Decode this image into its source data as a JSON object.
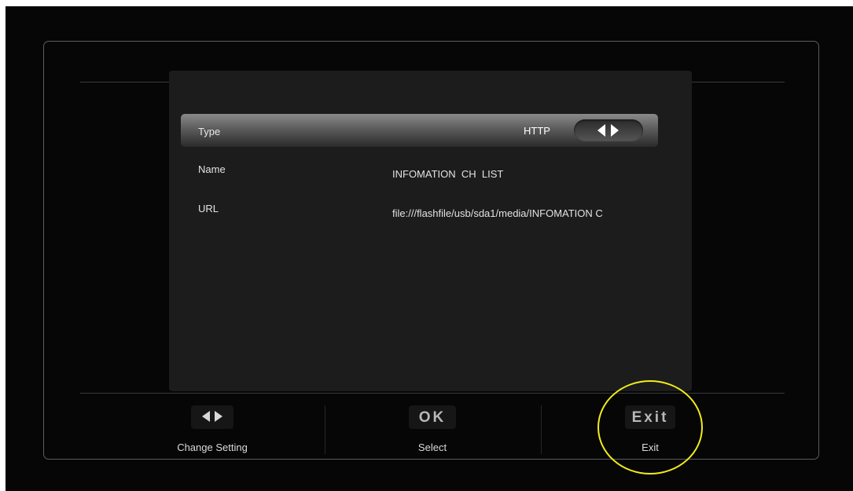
{
  "settings": {
    "rows": [
      {
        "label": "Type",
        "value": "HTTP"
      },
      {
        "label": "Name",
        "value": "INFOMATION  CH  LIST"
      },
      {
        "label": "URL",
        "value": "file:///flashfile/usb/sda1/media/INFOMATION C"
      }
    ],
    "selected_index": 0
  },
  "legend": {
    "change": {
      "key_icon": "left-right-arrows-icon",
      "caption": "Change Setting"
    },
    "select": {
      "key": "OK",
      "caption": "Select"
    },
    "exit": {
      "key": "Exit",
      "caption": "Exit"
    }
  },
  "annotation": {
    "color": "#f2ec1a",
    "target": "exit"
  }
}
